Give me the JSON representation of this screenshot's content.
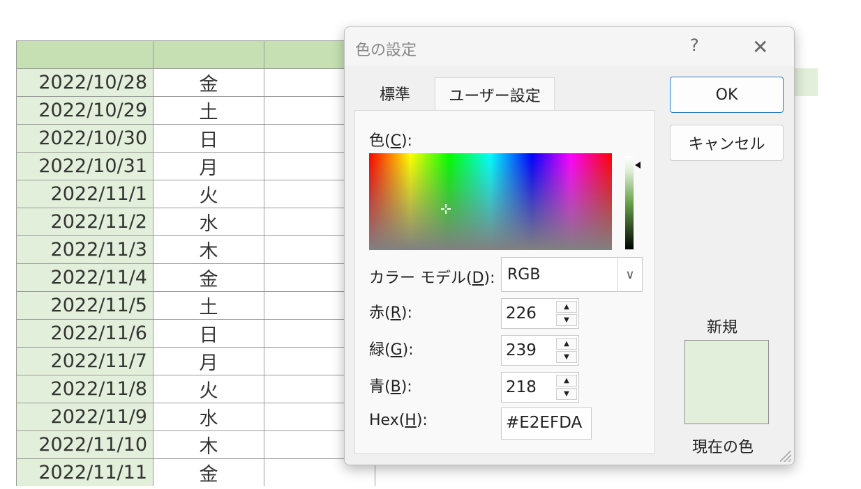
{
  "sheet": {
    "rows": [
      {
        "date": "2022/10/28",
        "day": "金"
      },
      {
        "date": "2022/10/29",
        "day": "土"
      },
      {
        "date": "2022/10/30",
        "day": "日"
      },
      {
        "date": "2022/10/31",
        "day": "月"
      },
      {
        "date": "2022/11/1",
        "day": "火"
      },
      {
        "date": "2022/11/2",
        "day": "水"
      },
      {
        "date": "2022/11/3",
        "day": "木"
      },
      {
        "date": "2022/11/4",
        "day": "金"
      },
      {
        "date": "2022/11/5",
        "day": "土"
      },
      {
        "date": "2022/11/6",
        "day": "日"
      },
      {
        "date": "2022/11/7",
        "day": "月"
      },
      {
        "date": "2022/11/8",
        "day": "火"
      },
      {
        "date": "2022/11/9",
        "day": "水"
      },
      {
        "date": "2022/11/10",
        "day": "木"
      },
      {
        "date": "2022/11/11",
        "day": "金"
      }
    ],
    "header_color": "#c6e0b4",
    "date_col_color": "#e2efda"
  },
  "dialog": {
    "title": "色の設定",
    "help_glyph": "?",
    "close_glyph": "✕",
    "tabs": [
      {
        "label": "標準",
        "active": false
      },
      {
        "label": "ユーザー設定",
        "active": true
      }
    ],
    "color_label": {
      "text": "色(",
      "key": "C",
      "end": "):"
    },
    "model_label": {
      "text": "カラー モデル(",
      "key": "D",
      "end": "):"
    },
    "model_value": "RGB",
    "red_label": {
      "text": "赤(",
      "key": "R",
      "end": "):"
    },
    "green_label": {
      "text": "緑(",
      "key": "G",
      "end": "):"
    },
    "blue_label": {
      "text": "青(",
      "key": "B",
      "end": "):"
    },
    "hex_label": {
      "text": "Hex(",
      "key": "H",
      "end": "):"
    },
    "red_value": "226",
    "green_value": "239",
    "blue_value": "218",
    "hex_value": "#E2EFDA",
    "ok_label": "OK",
    "cancel_label": "キャンセル",
    "new_label": "新規",
    "current_label": "現在の色",
    "preview_color": "#e2efda"
  }
}
